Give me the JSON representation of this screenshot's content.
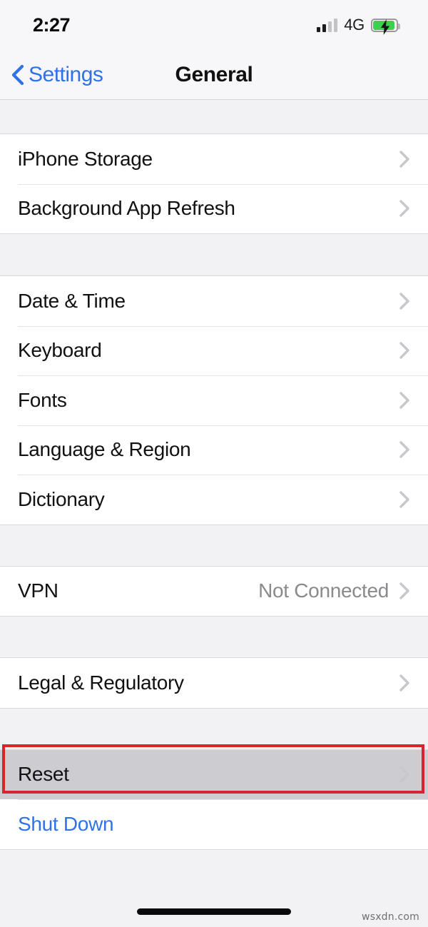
{
  "status_bar": {
    "time": "2:27",
    "network_label": "4G",
    "signal_icon": "cellular-signal-icon",
    "signal_bars_total": 4,
    "signal_bars_filled": 2,
    "battery_icon": "battery-charging-icon",
    "battery_charging": true,
    "battery_color": "#3bd14c",
    "bolt_glyph": "⚡"
  },
  "nav_bar": {
    "back_label": "Settings",
    "back_icon": "chevron-left-icon",
    "title": "General",
    "accent_color": "#2f72e8"
  },
  "sections": [
    {
      "id": "storage-section",
      "rows": [
        {
          "id": "iphone-storage",
          "label": "iPhone Storage",
          "value": "",
          "style": "default",
          "chevron": true
        },
        {
          "id": "background-app-refresh",
          "label": "Background App Refresh",
          "value": "",
          "style": "default",
          "chevron": true
        }
      ]
    },
    {
      "id": "localization-section",
      "rows": [
        {
          "id": "date-and-time",
          "label": "Date & Time",
          "value": "",
          "style": "default",
          "chevron": true
        },
        {
          "id": "keyboard",
          "label": "Keyboard",
          "value": "",
          "style": "default",
          "chevron": true
        },
        {
          "id": "fonts",
          "label": "Fonts",
          "value": "",
          "style": "default",
          "chevron": true
        },
        {
          "id": "language-and-region",
          "label": "Language & Region",
          "value": "",
          "style": "default",
          "chevron": true
        },
        {
          "id": "dictionary",
          "label": "Dictionary",
          "value": "",
          "style": "default",
          "chevron": true
        }
      ]
    },
    {
      "id": "vpn-section",
      "rows": [
        {
          "id": "vpn",
          "label": "VPN",
          "value": "Not Connected",
          "style": "default",
          "chevron": true
        }
      ]
    },
    {
      "id": "legal-section",
      "rows": [
        {
          "id": "legal-and-regulatory",
          "label": "Legal & Regulatory",
          "value": "",
          "style": "default",
          "chevron": true
        }
      ]
    },
    {
      "id": "reset-section",
      "rows": [
        {
          "id": "reset",
          "label": "Reset",
          "value": "",
          "style": "highlighted",
          "chevron": true
        },
        {
          "id": "shut-down",
          "label": "Shut Down",
          "value": "",
          "style": "link",
          "chevron": false
        }
      ]
    }
  ],
  "annotation": {
    "highlight_target": "Reset",
    "highlight_color": "#d9232e"
  },
  "watermark": {
    "text": "wsxdn.com"
  },
  "colors": {
    "page_background": "#f2f2f5",
    "row_background": "#ffffff",
    "separator": "#e4e4e6",
    "secondary_text": "#8a8a8e",
    "chevron": "#c7c7cc",
    "pressed_row": "#cdccd1"
  }
}
